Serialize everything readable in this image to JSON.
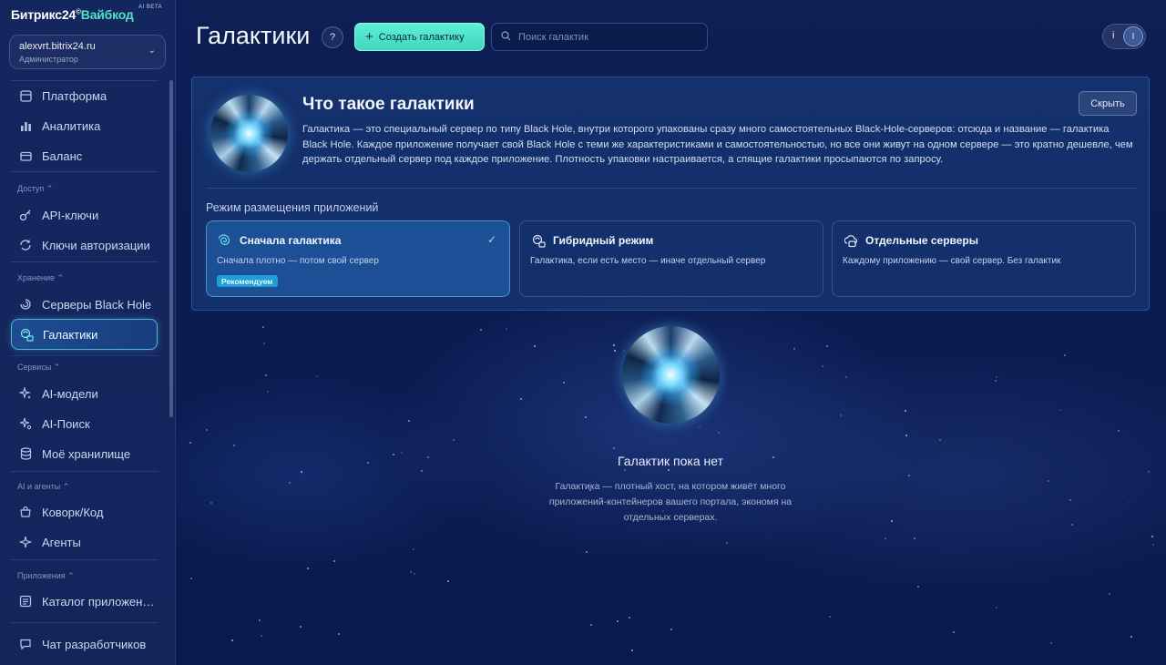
{
  "brand": {
    "name": "Битрикс24",
    "registered": "©",
    "product": "Вайбкод",
    "beta": "AI BETA"
  },
  "account": {
    "host": "alexvrt.bitrix24.ru",
    "role": "Администратор"
  },
  "sidebar": {
    "top_items": [
      {
        "label": "Платформа",
        "icon": "grid-icon"
      },
      {
        "label": "Аналитика",
        "icon": "bar-chart-icon"
      },
      {
        "label": "Баланс",
        "icon": "wallet-icon"
      }
    ],
    "sections": {
      "access": "Доступ",
      "storage": "Хранение",
      "services": "Сервисы",
      "ai_agents": "AI и агенты",
      "apps": "Приложения"
    },
    "access_items": [
      {
        "label": "API-ключи",
        "icon": "key-icon"
      },
      {
        "label": "Ключи авторизации",
        "icon": "refresh-key-icon"
      }
    ],
    "storage_items": [
      {
        "label": "Серверы Black Hole",
        "icon": "black-hole-icon"
      },
      {
        "label": "Галактики",
        "icon": "galaxy-server-icon"
      }
    ],
    "services_items": [
      {
        "label": "AI-модели",
        "icon": "sparkle-icon"
      },
      {
        "label": "AI-Поиск",
        "icon": "ai-search-icon"
      },
      {
        "label": "Моё хранилище",
        "icon": "database-icon"
      }
    ],
    "ai_items": [
      {
        "label": "Коворк/Код",
        "icon": "cowork-code-icon"
      },
      {
        "label": "Агенты",
        "icon": "agents-icon"
      }
    ],
    "apps_items": [
      {
        "label": "Каталог приложен…",
        "icon": "catalog-icon"
      }
    ],
    "bottom_item": {
      "label": "Чат разработчиков",
      "icon": "chat-icon"
    }
  },
  "header": {
    "title": "Галактики",
    "help": "?",
    "create_button": "Создать галактику",
    "search_placeholder": "Поиск галактик",
    "user_initial": "i",
    "avatar_initial": "I"
  },
  "info_panel": {
    "title": "Что такое галактики",
    "description": "Галактика — это специальный сервер по типу Black Hole, внутри которого упакованы сразу много самостоятельных Black-Hole-серверов: отсюда и название — галактика Black Hole. Каждое приложение получает свой Black Hole с теми же характеристиками и самостоятельностью, но все они живут на одном сервере — это кратно дешевле, чем держать отдельный сервер под каждое приложение. Плотность упаковки настраивается, а спящие галактики просыпаются по запросу.",
    "hide_button": "Скрыть",
    "mode_label": "Режим размещения приложений",
    "modes": [
      {
        "name": "Сначала галактика",
        "desc": "Сначала плотно — потом свой сервер",
        "badge": "Рекомендуем",
        "selected": true
      },
      {
        "name": "Гибридный режим",
        "desc": "Галактика, если есть место — иначе отдельный сервер",
        "selected": false
      },
      {
        "name": "Отдельные серверы",
        "desc": "Каждому приложению — свой сервер. Без галактик",
        "selected": false
      }
    ]
  },
  "empty_state": {
    "title": "Галактик пока нет",
    "description": "Галактика — плотный хост, на котором живёт много приложений-контейнеров вашего портала, экономя на отдельных серверах."
  },
  "colors": {
    "accent": "#4fe3c8",
    "active_border": "#5ad2e6",
    "background": "#0b1a4a"
  }
}
